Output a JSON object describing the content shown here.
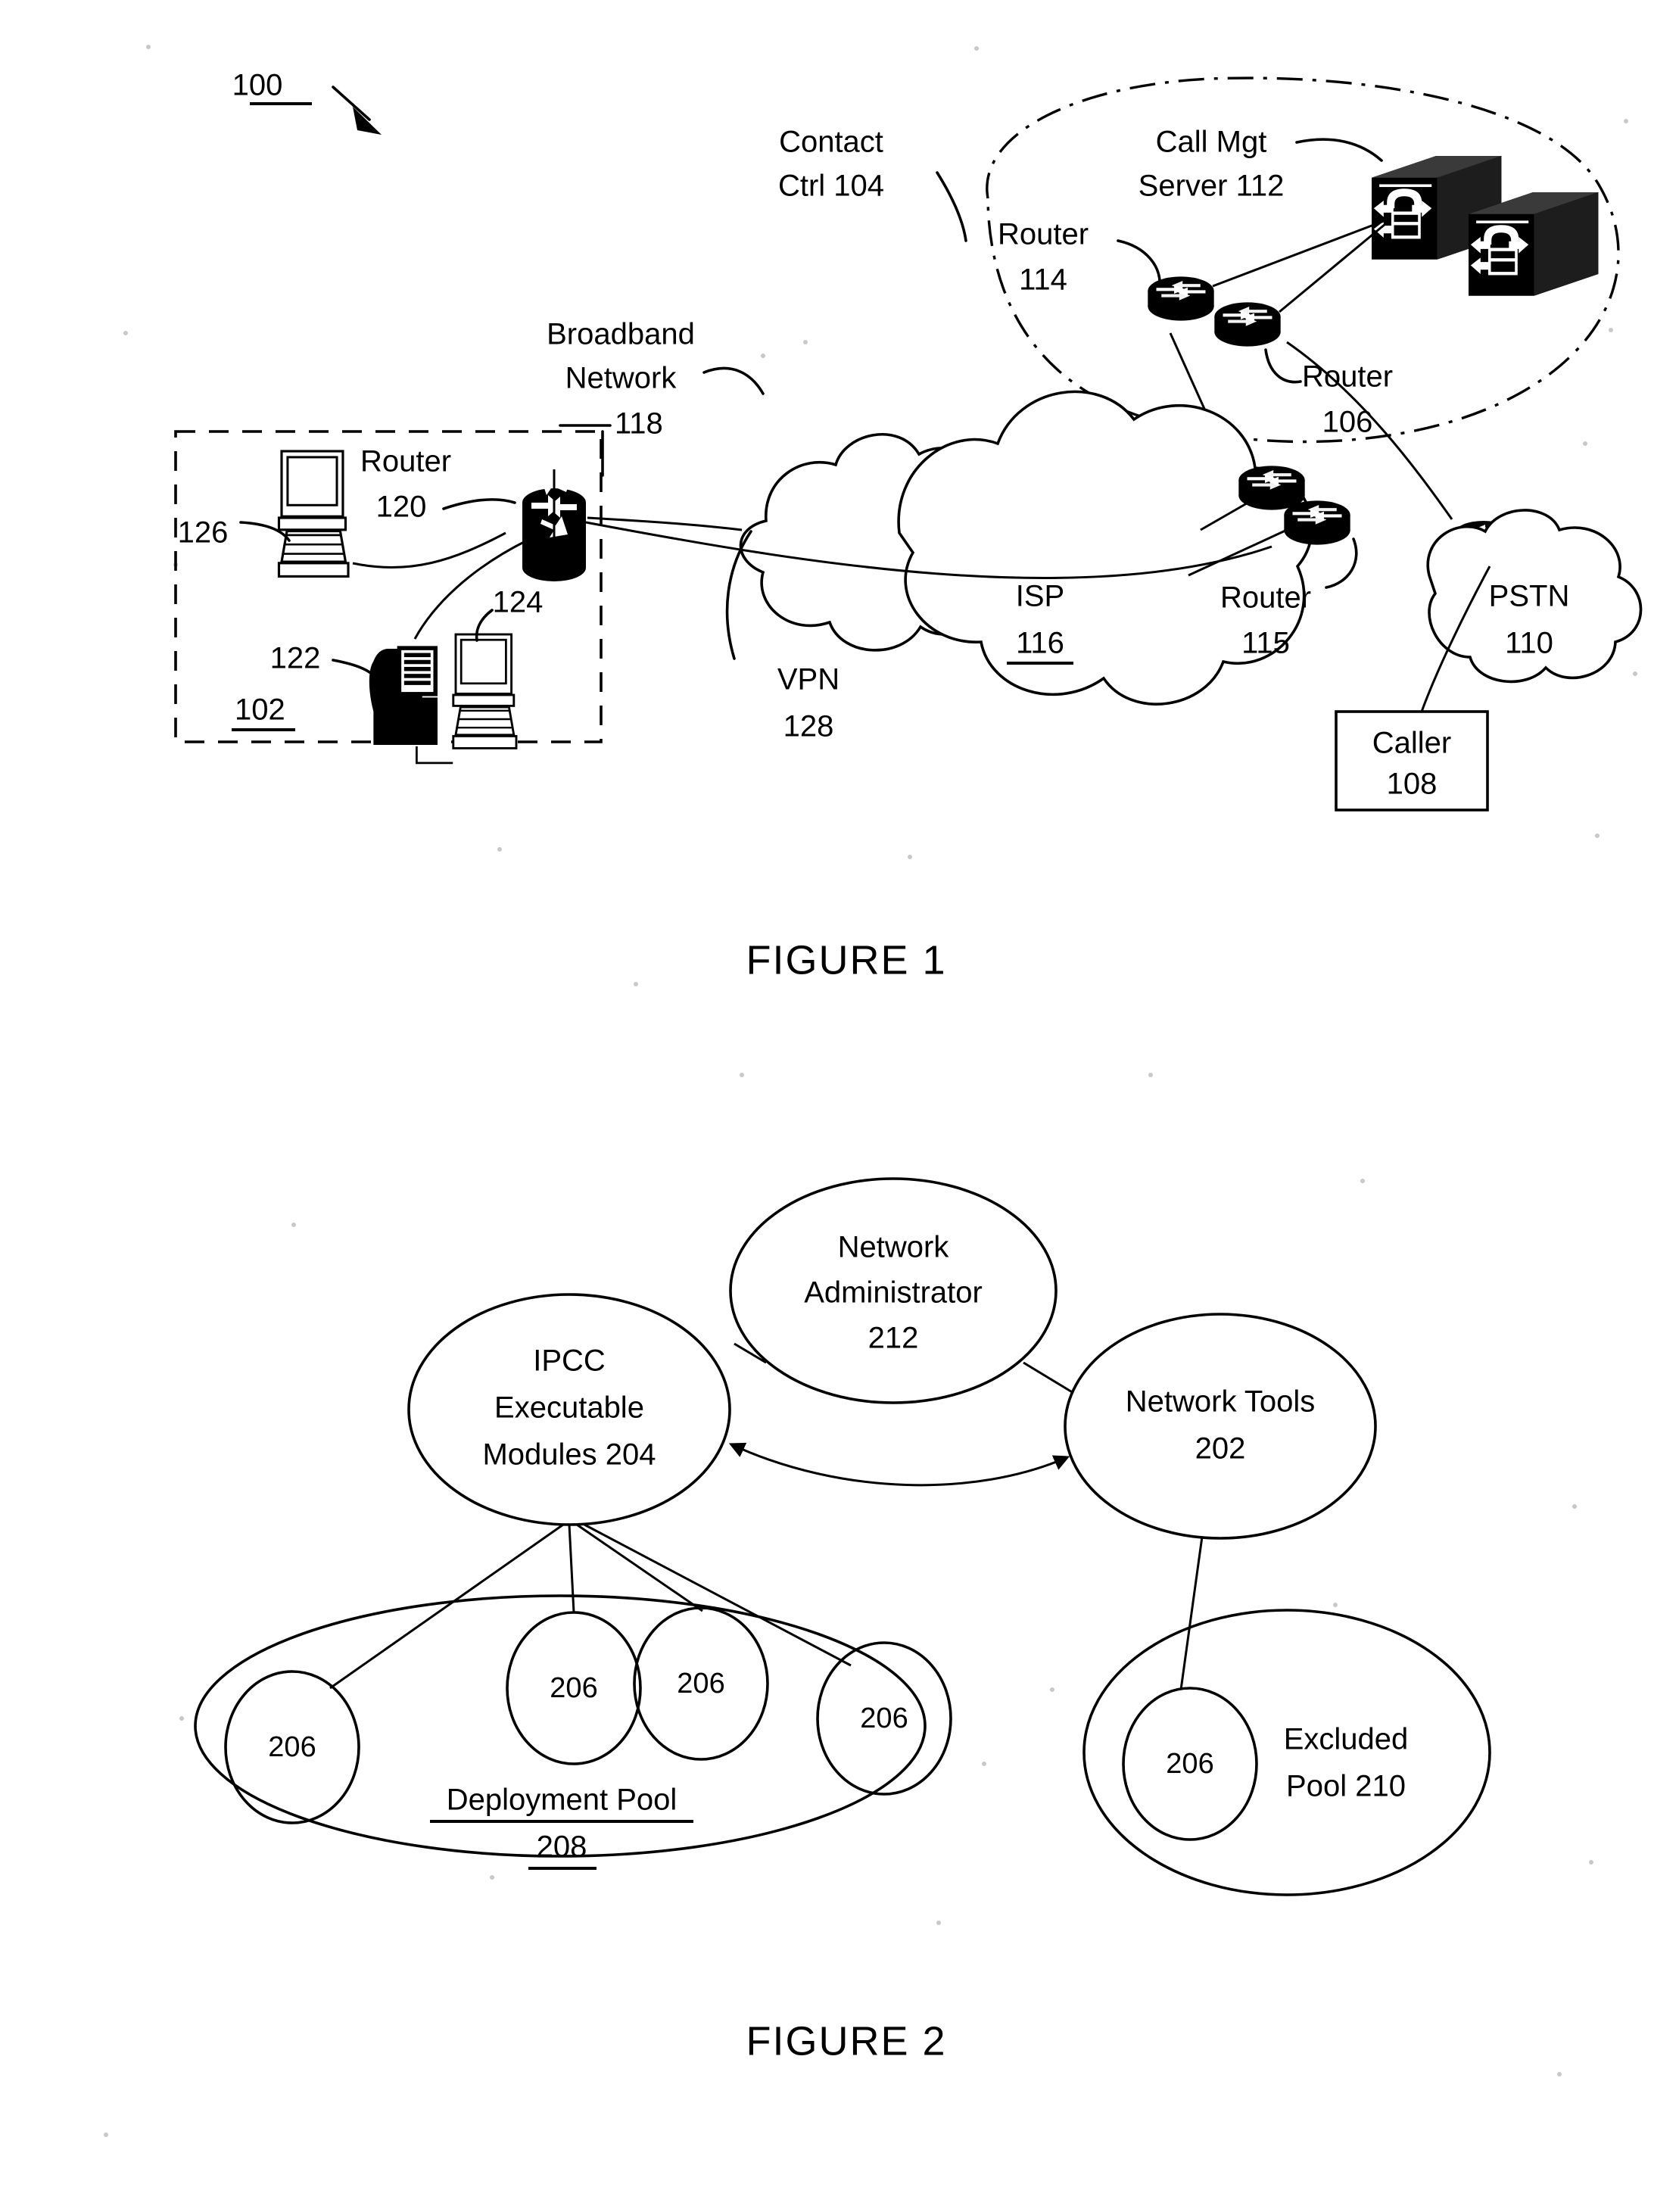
{
  "page": {
    "background": "#ffffff",
    "ink": "#000000"
  },
  "figure1": {
    "caption": "FIGURE 1",
    "ref_numeral": "100",
    "labels": {
      "contact_ctrl": "Contact",
      "contact_ctrl_2": "Ctrl 104",
      "call_mgt_server": "Call Mgt",
      "call_mgt_server_2": "Server 112",
      "router_114": "Router",
      "router_114_num": "114",
      "router_106": "Router",
      "router_106_num": "106",
      "router_115": "Router",
      "router_115_num": "115",
      "router_120": "Router",
      "router_120_num": "120",
      "broadband_network": "Broadband",
      "broadband_network_2": "Network",
      "broadband_network_num": "118",
      "isp": "ISP",
      "isp_num": "116",
      "vpn": "VPN",
      "vpn_num": "128",
      "pstn": "PSTN",
      "pstn_num": "110",
      "caller": "Caller",
      "caller_num": "108",
      "endpoint_126": "126",
      "endpoint_122": "122",
      "endpoint_124": "124",
      "site_102": "102"
    }
  },
  "figure2": {
    "caption": "FIGURE 2",
    "nodes": {
      "network_admin_l1": "Network",
      "network_admin_l2": "Administrator",
      "network_admin_l3": "212",
      "ipcc_l1": "IPCC",
      "ipcc_l2": "Executable",
      "ipcc_l3": "Modules 204",
      "network_tools_l1": "Network Tools",
      "network_tools_l2": "202",
      "deployment_pool_l1": "Deployment Pool",
      "deployment_pool_l2": "208",
      "excluded_pool_l1": "Excluded",
      "excluded_pool_l2": "Pool 210"
    },
    "modules": {
      "label": "206",
      "deployment_count": 4,
      "excluded_count": 1
    }
  }
}
